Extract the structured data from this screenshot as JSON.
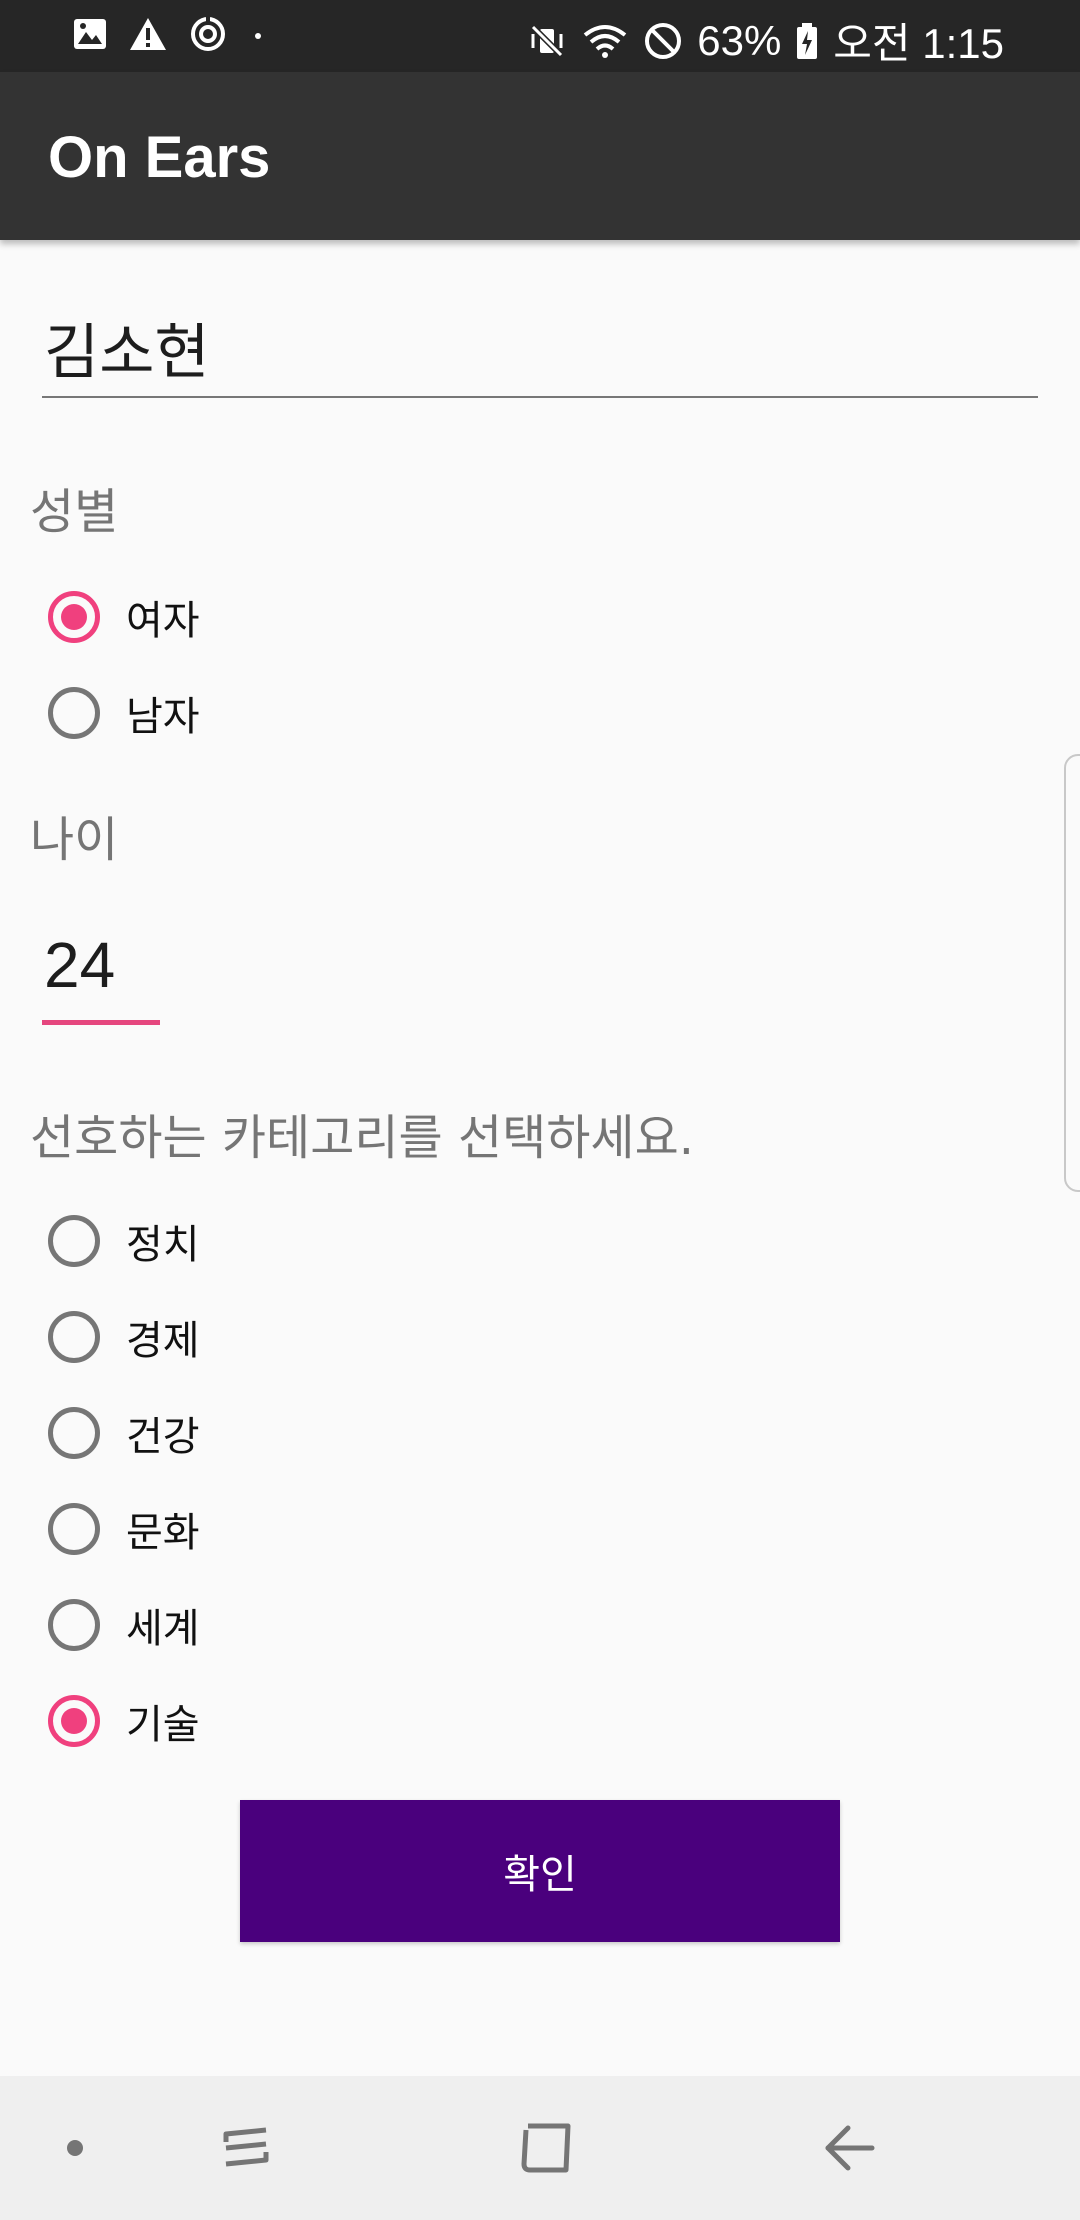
{
  "status_bar": {
    "left_icons": [
      "image-icon",
      "warning-icon",
      "sync-icon",
      "dot-icon"
    ],
    "right_icons": [
      "vibrate-icon",
      "wifi-icon",
      "blocked-icon",
      "battery-icon"
    ],
    "battery_text": "63%",
    "time_text": "오전 1:15"
  },
  "app_bar": {
    "title": "On Ears"
  },
  "form": {
    "name_value": "김소현",
    "gender_label": "성별",
    "gender_options": [
      {
        "label": "여자",
        "checked": true
      },
      {
        "label": "남자",
        "checked": false
      }
    ],
    "age_label": "나이",
    "age_value": "24",
    "category_prompt": "선호하는 카테고리를 선택하세요.",
    "category_options": [
      {
        "label": "정치",
        "checked": false
      },
      {
        "label": "경제",
        "checked": false
      },
      {
        "label": "건강",
        "checked": false
      },
      {
        "label": "문화",
        "checked": false
      },
      {
        "label": "세계",
        "checked": false
      },
      {
        "label": "기술",
        "checked": true
      }
    ],
    "confirm_label": "확인"
  },
  "colors": {
    "accent": "#f0407e",
    "button": "#4a007d",
    "app_bar": "#333333",
    "status_bar": "#262626"
  },
  "nav_bar": {
    "icons": [
      "dot-icon",
      "recent-apps-icon",
      "home-icon",
      "back-icon"
    ]
  }
}
